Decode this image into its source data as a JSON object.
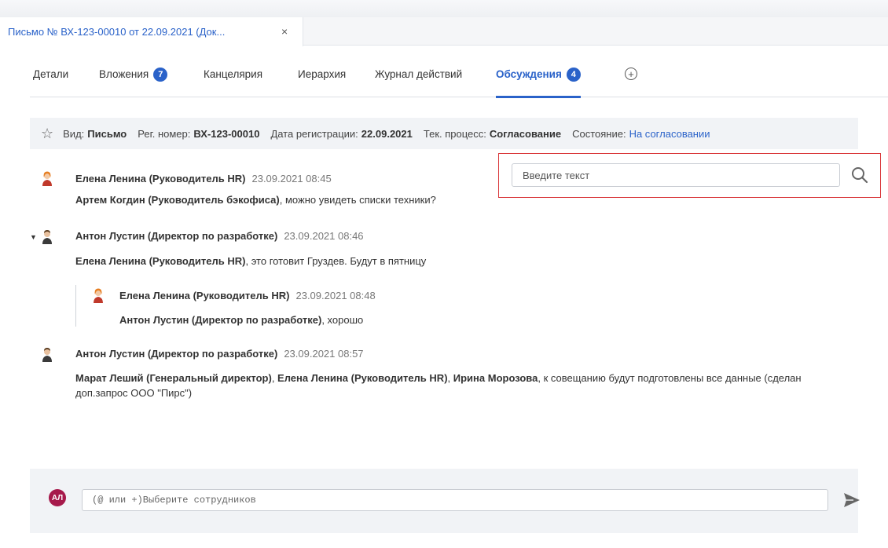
{
  "document_tab": {
    "title": "Письмо № ВХ-123-00010 от 22.09.2021 (Док...",
    "close": "×"
  },
  "tabs": [
    {
      "label": "Детали"
    },
    {
      "label": "Вложения",
      "badge": "7"
    },
    {
      "label": "Канцелярия"
    },
    {
      "label": "Иерархия"
    },
    {
      "label": "Журнал действий"
    },
    {
      "label": "Обсуждения",
      "badge": "4",
      "active": true
    }
  ],
  "add_tab": "+",
  "info": {
    "type_label": "Вид:",
    "type_value": "Письмо",
    "reg_label": "Рег. номер:",
    "reg_value": "ВХ-123-00010",
    "date_label": "Дата регистрации:",
    "date_value": "22.09.2021",
    "process_label": "Тек. процесс:",
    "process_value": "Согласование",
    "state_label": "Состояние:",
    "state_value": "На согласовании"
  },
  "search": {
    "placeholder": "Введите текст"
  },
  "messages": [
    {
      "author": "Елена Ленина (Руководитель HR)",
      "time": "23.09.2021 08:45",
      "mention": "Артем Когдин (Руководитель бэкофиса)",
      "text": ", можно увидеть списки техники?"
    },
    {
      "author": "Антон Лустин (Директор по разработке)",
      "time": "23.09.2021 08:46",
      "mention": "Елена Ленина (Руководитель HR)",
      "text": ", это готовит Груздев. Будут в пятницу"
    },
    {
      "author": "Елена Ленина (Руководитель HR)",
      "time": "23.09.2021 08:48",
      "mention": "Антон Лустин (Директор по разработке)",
      "text": ", хорошо"
    },
    {
      "author": "Антон Лустин (Директор по разработке)",
      "time": "23.09.2021 08:57",
      "mention1": "Марат Леший (Генеральный директор)",
      "sep1": ", ",
      "mention2": "Елена Ленина (Руководитель HR)",
      "sep2": ", ",
      "mention3": "Ирина Морозова",
      "text": ", к совещанию будут подготовлены все данные (сделан доп.запрос ООО \"Пирс\")"
    }
  ],
  "composer": {
    "avatar": "АЛ",
    "placeholder": "(@ или +)Выберите сотрудников"
  },
  "colors": {
    "accent": "#2a62c9",
    "highlight_frame": "#d9373a",
    "avatar_me": "#a6194b"
  },
  "icons": {
    "star": "star-icon",
    "search": "search-icon",
    "send": "send-icon",
    "female": "user-female-icon",
    "male": "user-male-icon"
  }
}
